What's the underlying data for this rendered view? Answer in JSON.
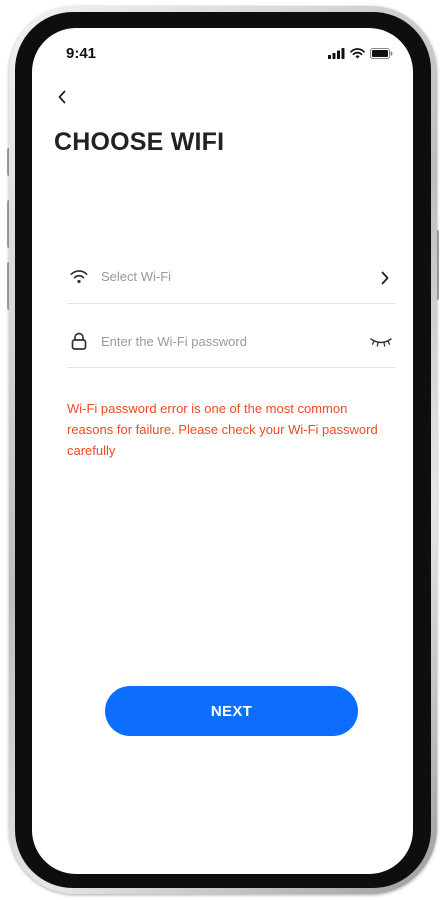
{
  "status_bar": {
    "time": "9:41",
    "icons": [
      "signal-icon",
      "wifi-icon",
      "battery-icon"
    ]
  },
  "header": {
    "back_icon": "chevron-left-icon",
    "title": "CHOOSE WIFI"
  },
  "form": {
    "wifi_select": {
      "icon": "wifi-icon",
      "placeholder": "Select Wi-Fi",
      "value": "",
      "trailing_icon": "chevron-right-icon"
    },
    "password": {
      "icon": "lock-icon",
      "placeholder": "Enter the Wi-Fi password",
      "value": "",
      "trailing_icon": "eye-closed-icon"
    },
    "error_message": "Wi-Fi password error is one of the most common reasons for failure. Please check your Wi-Fi password carefully"
  },
  "actions": {
    "next_label": "NEXT"
  },
  "colors": {
    "accent": "#0d6efd",
    "error": "#f04a22",
    "title": "#222222",
    "placeholder": "#9a9a9a"
  }
}
